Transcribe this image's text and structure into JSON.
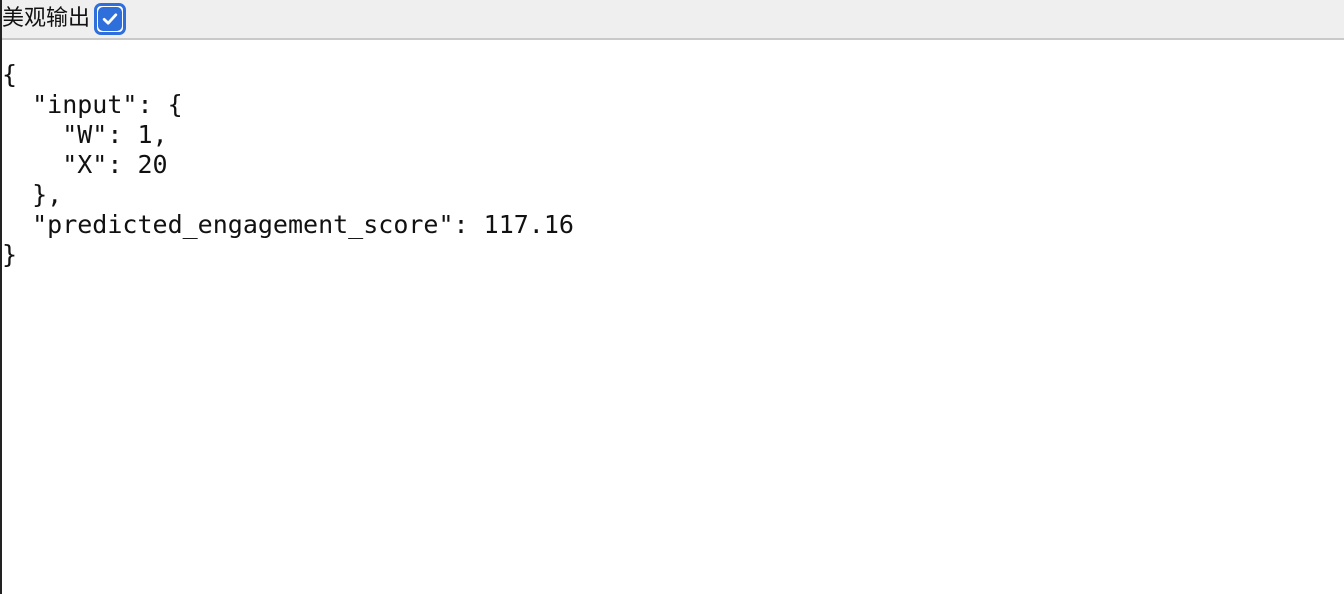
{
  "toolbar": {
    "pretty_label": "美观输出",
    "pretty_checked": true,
    "accent_color": "#2f6fdc",
    "checkbox_icon": "check-icon"
  },
  "output": {
    "lines": [
      "{",
      "  \"input\": {",
      "    \"W\": 1,",
      "    \"X\": 20",
      "  },",
      "  \"predicted_engagement_score\": 117.16",
      "}"
    ]
  }
}
